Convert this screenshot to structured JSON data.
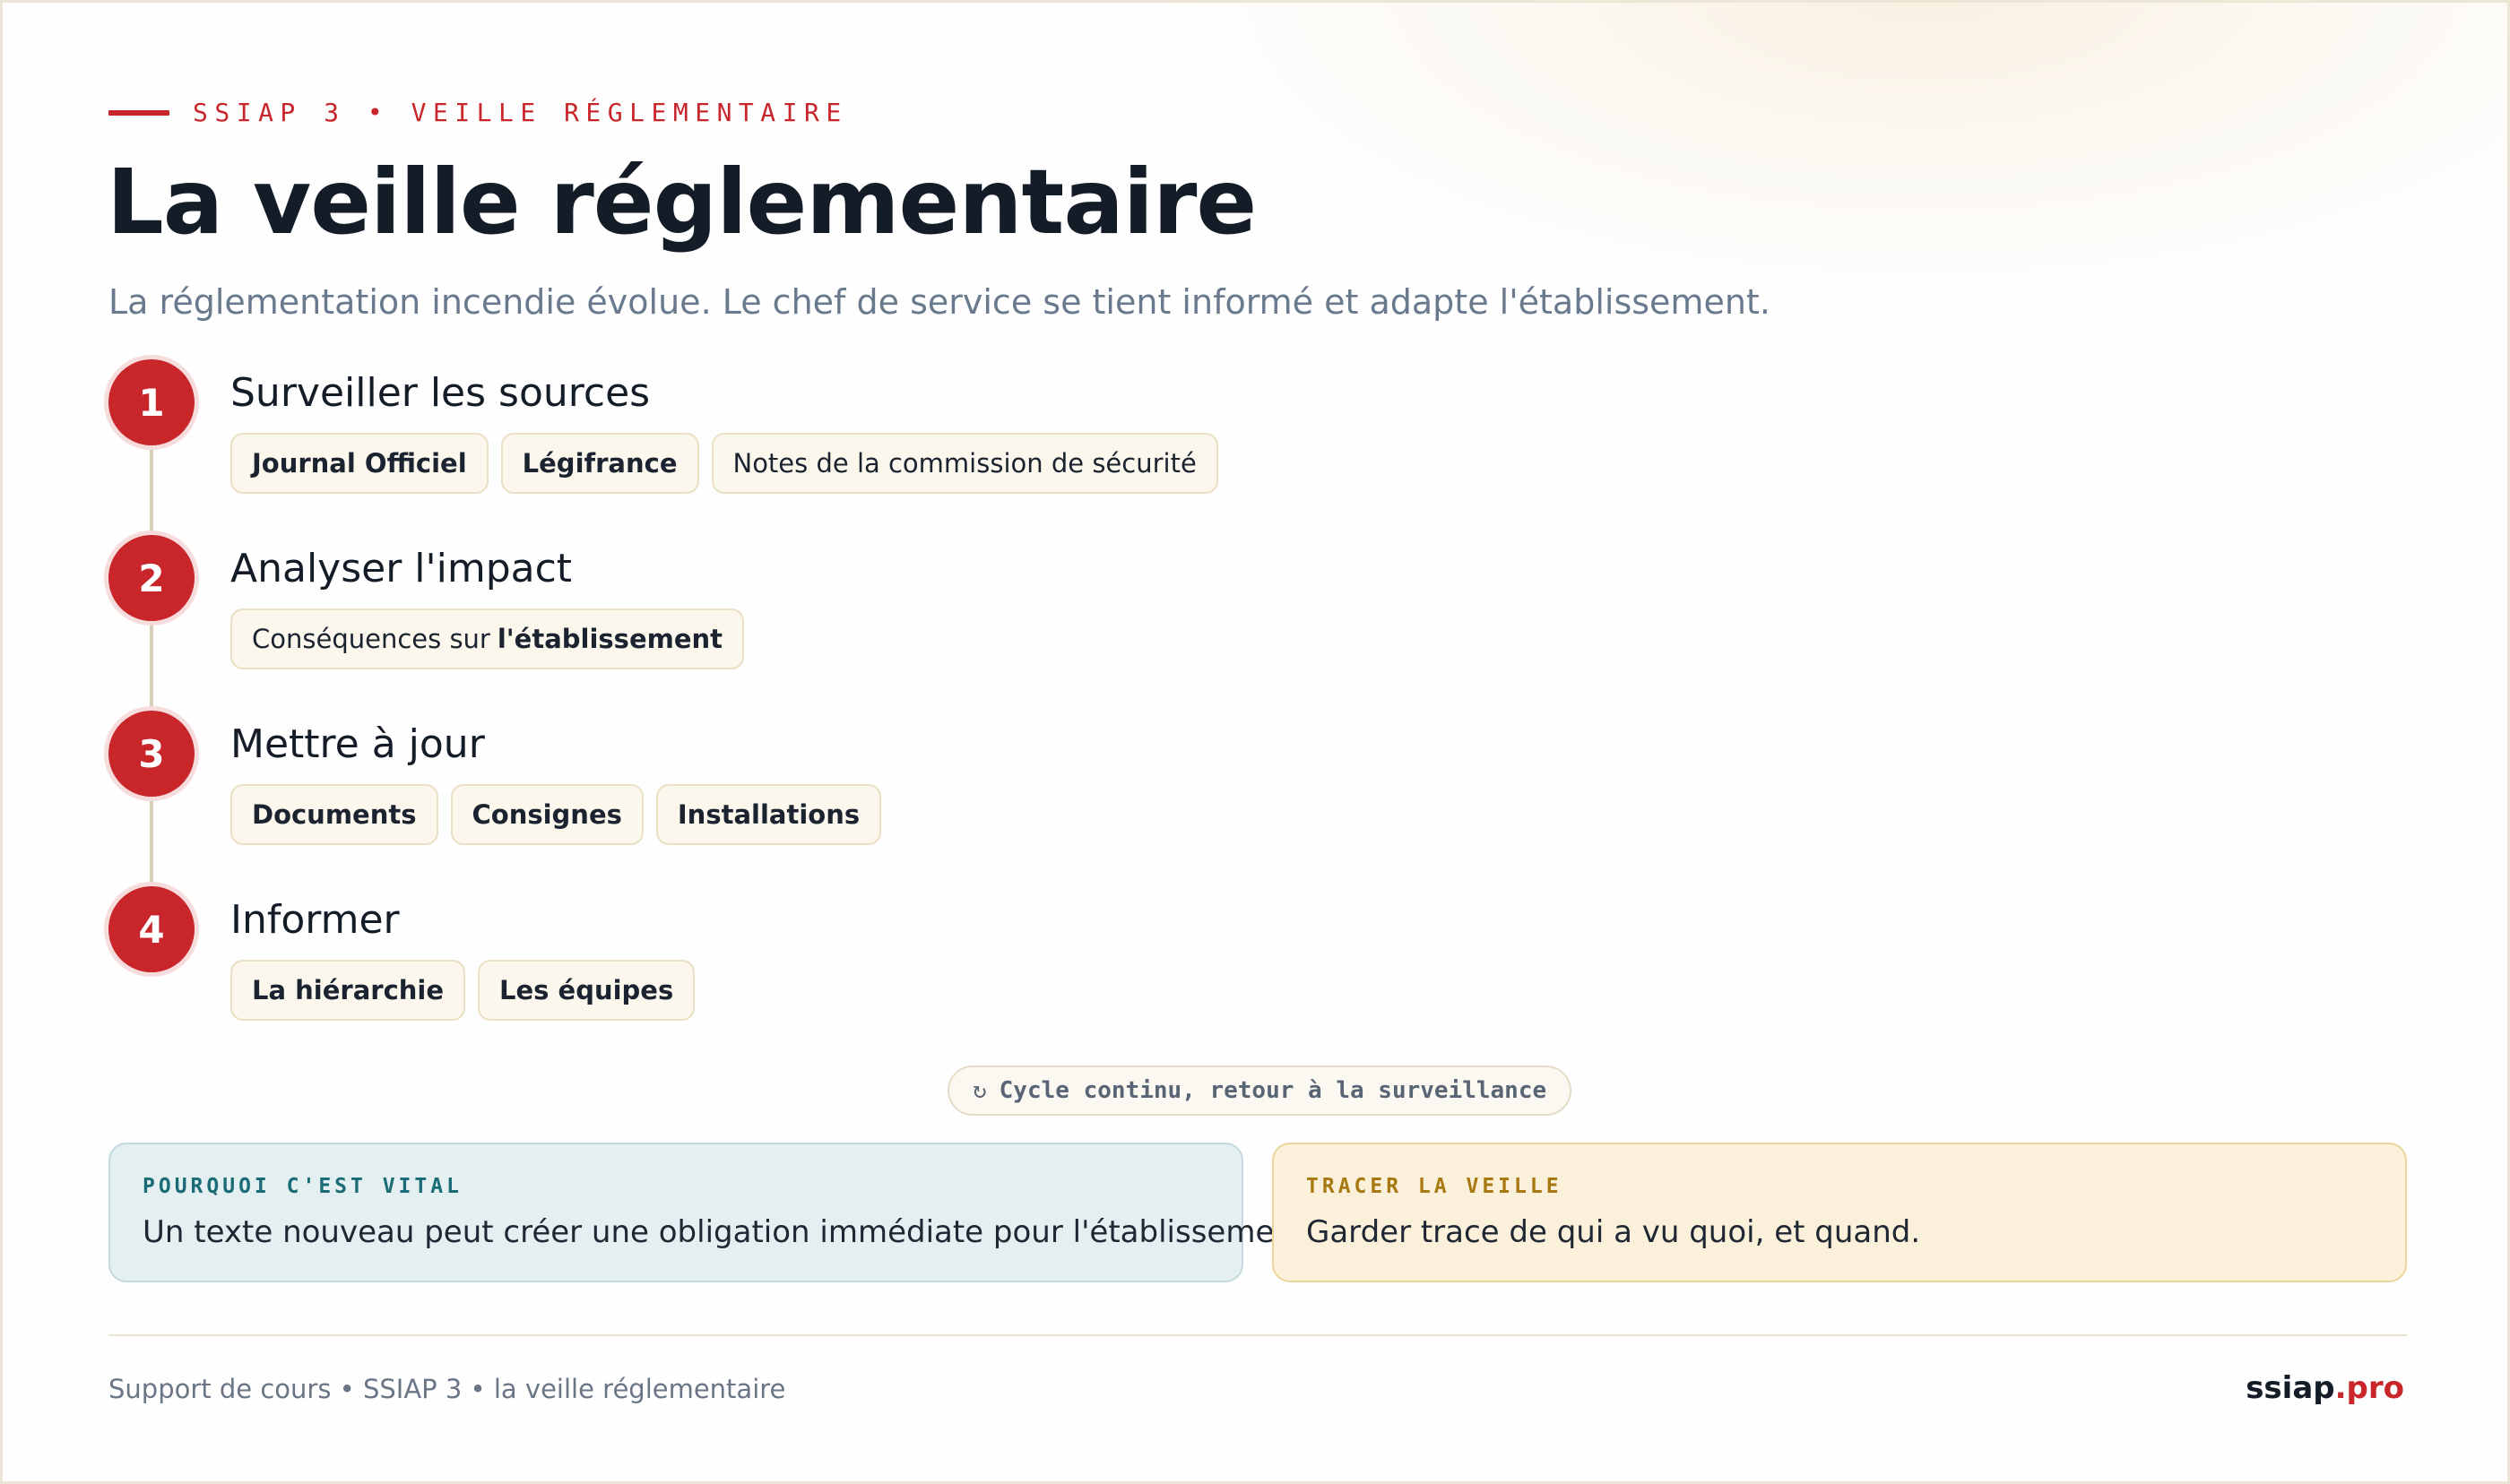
{
  "colors": {
    "accent": "#c8262b",
    "title": "#141c28",
    "subtitle": "#6a7a8e",
    "chip_bg": "#fbf7ec",
    "vital_bg": "#e3eff0",
    "vital_label": "#1a6b76",
    "trace_bg": "#fbf0d9",
    "trace_label": "#a87910"
  },
  "header": {
    "kicker": "SSIAP 3 • VEILLE RÉGLEMENTAIRE",
    "title": "La veille réglementaire",
    "subtitle": "La réglementation incendie évolue. Le chef de service se tient informé et adapte l'établissement."
  },
  "steps": [
    {
      "number": "1",
      "title": "Surveiller les sources",
      "chips": [
        "Journal Officiel",
        "Légifrance",
        "Notes de la commission de sécurité"
      ]
    },
    {
      "number": "2",
      "title": "Analyser l'impact",
      "chip_prefix": "Conséquences sur",
      "chip_bold": "l'établissement"
    },
    {
      "number": "3",
      "title": "Mettre à jour",
      "chips": [
        "Documents",
        "Consignes",
        "Installations"
      ]
    },
    {
      "number": "4",
      "title": "Informer",
      "chips": [
        "La hiérarchie",
        "Les équipes"
      ]
    }
  ],
  "cycle": {
    "icon": "refresh-icon",
    "symbol": "↻",
    "text": "Cycle continu, retour à la surveillance"
  },
  "cards": {
    "vital": {
      "label": "POURQUOI C'EST VITAL",
      "text": "Un texte nouveau peut créer une obligation immédiate pour l'établissement."
    },
    "trace": {
      "label": "TRACER LA VEILLE",
      "text": "Garder trace de qui a vu quoi, et quand."
    }
  },
  "footer": {
    "left": "Support de cours • SSIAP 3 • la veille réglementaire",
    "brand_name": "ssiap",
    "brand_tld": ".pro"
  }
}
